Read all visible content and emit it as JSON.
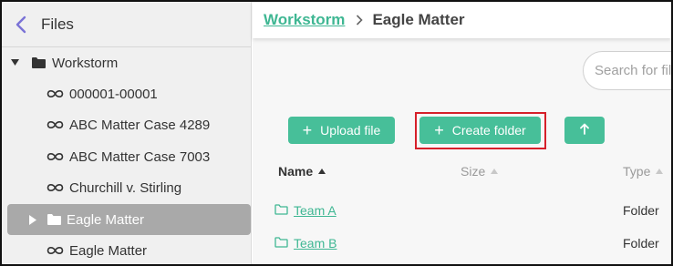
{
  "sidebar": {
    "title": "Files",
    "items": [
      {
        "label": "Workstorm",
        "icon": "folder-icon",
        "expander": "caret-down-icon"
      },
      {
        "label": "000001-00001",
        "icon": "link-icon"
      },
      {
        "label": "ABC Matter Case 4289",
        "icon": "link-icon"
      },
      {
        "label": "ABC Matter Case 7003",
        "icon": "link-icon"
      },
      {
        "label": "Churchill v. Stirling",
        "icon": "link-icon"
      },
      {
        "label": "Eagle Matter",
        "icon": "folder-icon",
        "expander": "caret-right-icon",
        "selected": true
      },
      {
        "label": "Eagle Matter",
        "icon": "link-icon"
      }
    ]
  },
  "breadcrumb": {
    "root": "Workstorm",
    "current": "Eagle Matter"
  },
  "search": {
    "placeholder": "Search for files"
  },
  "toolbar": {
    "upload_label": "Upload file",
    "create_folder_label": "Create folder",
    "up_icon": "arrow-up-icon"
  },
  "table": {
    "columns": {
      "name": "Name",
      "size": "Size",
      "type": "Type"
    },
    "rows": [
      {
        "name": "Team A",
        "type": "Folder"
      },
      {
        "name": "Team B",
        "type": "Folder"
      }
    ]
  },
  "colors": {
    "accent": "#47bf99",
    "link": "#3fb793",
    "highlight_border": "#d6202a",
    "selected_row": "#a9a9a9",
    "back_icon": "#7a72d6"
  }
}
